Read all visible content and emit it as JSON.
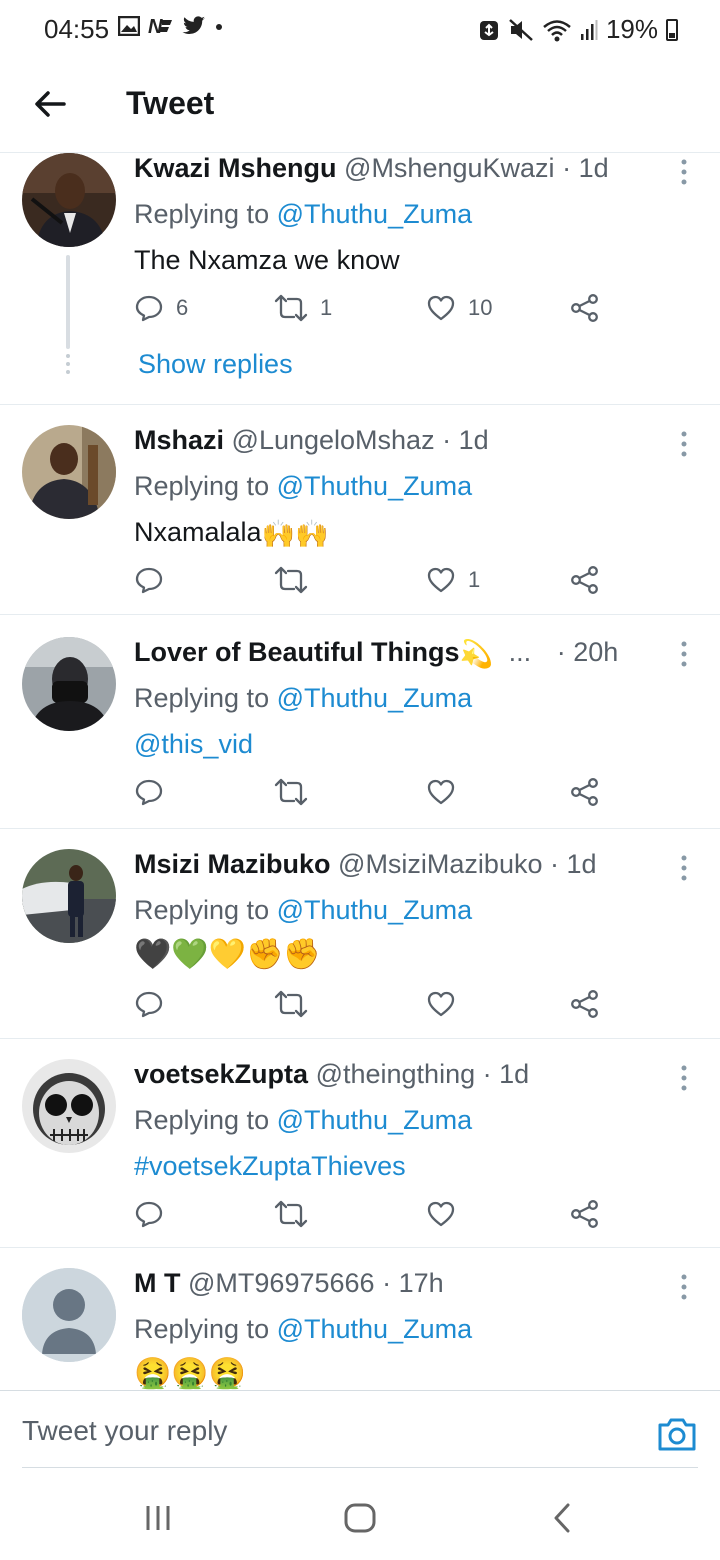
{
  "status_bar": {
    "time": "04:55",
    "battery_percent": "19%"
  },
  "header": {
    "title": "Tweet"
  },
  "tweets": [
    {
      "name": "Kwazi Mshengu",
      "handle": "@MshenguKwazi",
      "time": "1d",
      "replying_prefix": "Replying to",
      "replying_to": "@Thuthu_Zuma",
      "text": "The Nxamza we know",
      "reply_count": "6",
      "retweet_count": "1",
      "like_count": "10",
      "show_replies": "Show replies"
    },
    {
      "name": "Mshazi",
      "handle": "@LungeloMshaz",
      "time": "1d",
      "replying_prefix": "Replying to",
      "replying_to": "@Thuthu_Zuma",
      "text": "Nxamalala",
      "text_emoji": "🙌🙌",
      "like_count": "1"
    },
    {
      "name": "Lover of Beautiful Things",
      "name_emoji": "💫",
      "ellipsis": "...",
      "time": "20h",
      "replying_prefix": "Replying to",
      "replying_to": "@Thuthu_Zuma",
      "text": "@this_vid"
    },
    {
      "name": "Msizi Mazibuko",
      "handle": "@MsiziMazibuko",
      "time": "1d",
      "replying_prefix": "Replying to",
      "replying_to": "@Thuthu_Zuma",
      "text": "🖤💚💛✊✊"
    },
    {
      "name": "voetsekZupta",
      "handle": "@theingthing",
      "time": "1d",
      "replying_prefix": "Replying to",
      "replying_to": "@Thuthu_Zuma",
      "text": "#voetsekZuptaThieves"
    },
    {
      "name": "M T",
      "handle": "@MT96975666",
      "time": "17h",
      "replying_prefix": "Replying to",
      "replying_to": "@Thuthu_Zuma",
      "text": "🤮🤮🤮"
    }
  ],
  "reply_bar": {
    "placeholder": "Tweet your reply"
  },
  "colors": {
    "accent": "#1d8bd1",
    "text": "#14171a",
    "muted": "#586069",
    "divider": "#e6ecf0"
  }
}
